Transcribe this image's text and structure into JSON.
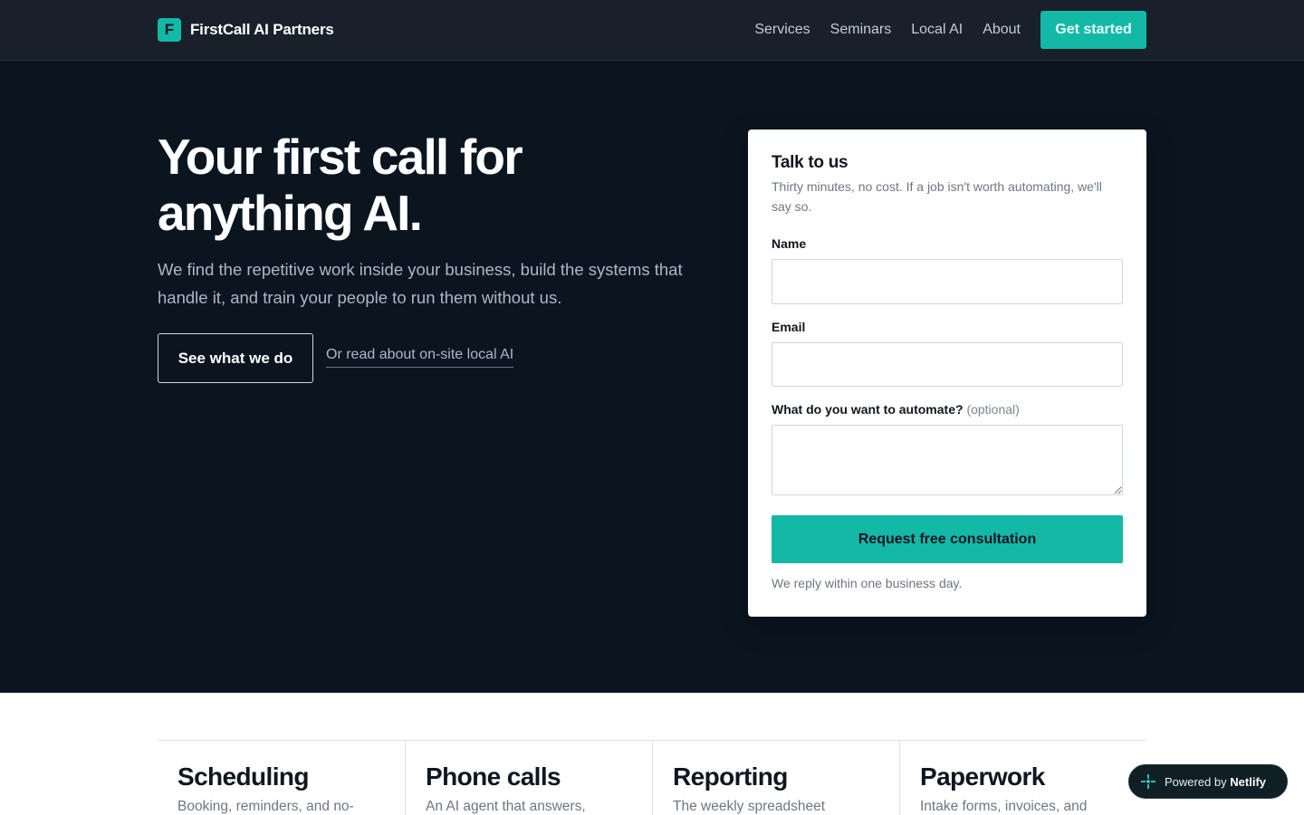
{
  "nav": {
    "logo_letter": "F",
    "brand": "FirstCall AI Partners",
    "links": [
      "Services",
      "Seminars",
      "Local AI",
      "About"
    ],
    "cta": "Get started"
  },
  "hero": {
    "title": "Your first call for anything AI.",
    "subtitle": "We find the repetitive work inside your business, build the systems that handle it, and train your people to run them without us.",
    "primary_button": "See what we do",
    "secondary_link": "Or read about on-site local AI"
  },
  "form": {
    "title": "Talk to us",
    "subtitle": "Thirty minutes, no cost. If a job isn't worth automating, we'll say so.",
    "name_label": "Name",
    "name_value": "",
    "email_label": "Email",
    "email_value": "",
    "automate_label": "What do you want to automate?",
    "automate_optional": "(optional)",
    "automate_value": "",
    "submit": "Request free consultation",
    "note": "We reply within one business day."
  },
  "services": [
    {
      "title": "Scheduling",
      "desc": "Booking, reminders, and no-"
    },
    {
      "title": "Phone calls",
      "desc": "An AI agent that answers,"
    },
    {
      "title": "Reporting",
      "desc": "The weekly spreadsheet"
    },
    {
      "title": "Paperwork",
      "desc": "Intake forms, invoices, and"
    }
  ],
  "badge": {
    "prefix": "Powered by",
    "brand": "Netlify",
    "icon": "netlify-icon"
  },
  "colors": {
    "accent": "#14b8a6",
    "hero_bg": "#0b1520",
    "nav_bg": "#18212b"
  }
}
